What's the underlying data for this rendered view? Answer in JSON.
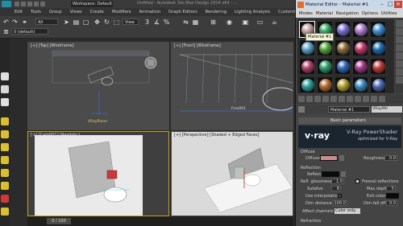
{
  "window": {
    "workspace": "Workspace: Default",
    "title": "Untitled - Autodesk 3ds Max Design 2014 x64 - ..."
  },
  "menubar": [
    "Edit",
    "Tools",
    "Group",
    "Views",
    "Create",
    "Modifiers",
    "Animation",
    "Graph Editors",
    "Rendering",
    "Lighting Analysis",
    "Customize",
    "MAXScript",
    "Help"
  ],
  "toolbar": {
    "selection_filter": "All",
    "layer": "0 (default)",
    "view": "View"
  },
  "viewports": {
    "top": "[+] [Top] [Wireframe]",
    "front": "[+] [Front] [Wireframe]",
    "camera": "[+] [Cam001] [Realistic]",
    "perspective": "[+] [Perspective] [Shaded + Edged Faces]",
    "object_label": "VRayPlane",
    "light_label": "Free001"
  },
  "timeline": {
    "frame": "0 / 100"
  },
  "material_editor": {
    "title": "Material Editor - Material #1",
    "menu": [
      "Modes",
      "Material",
      "Navigation",
      "Options",
      "Utilities"
    ],
    "tooltip": "Material #1",
    "slot_colors": [
      "#c0a0a0",
      "#36a862",
      "#7a6fd0",
      "#b07cd0",
      "#3f8fd0",
      "#5aa0c8",
      "#54a23a",
      "#8a6a3a",
      "#c23a6a",
      "#1f6ab0",
      "#b0406a",
      "#2a9a6a",
      "#2f6ab8",
      "#a03a8a",
      "#c03b3b",
      "#2aa09a",
      "#b06a2a",
      "#b0a030",
      "#3a8ac0",
      "#4a6ab0"
    ],
    "material_name": "Material #1",
    "material_type": "VRayMtl",
    "rollout_title": "Basic parameters",
    "banner": {
      "logo": "v·ray",
      "title": "V-Ray PowerShader",
      "subtitle": "optimized for V-Ray"
    },
    "params": {
      "diffuse_section": "Diffuse",
      "diffuse_label": "Diffuse",
      "roughness_label": "Roughness",
      "roughness_value": "0.0",
      "diffuse_color": "#c88e8e",
      "reflection_section": "Reflection",
      "reflect_label": "Reflect",
      "refl_gloss_label": "Refl. glossiness",
      "refl_gloss_value": "1.0",
      "fresnel_label": "Fresnel reflections",
      "subdivs_label": "Subdivs",
      "subdivs_value": "8",
      "max_depth_label": "Max depth",
      "max_depth_value": "5",
      "use_interp_label": "Use interpolation",
      "exit_color_label": "Exit color",
      "dim_distance_label": "Dim distance",
      "dim_distance_value": "100.0",
      "dim_falloff_label": "Dim fall off",
      "dim_falloff_value": "0.0",
      "affect_channels_label": "Affect channels",
      "affect_channels_value": "Color only",
      "refraction_section": "Refraction"
    }
  }
}
